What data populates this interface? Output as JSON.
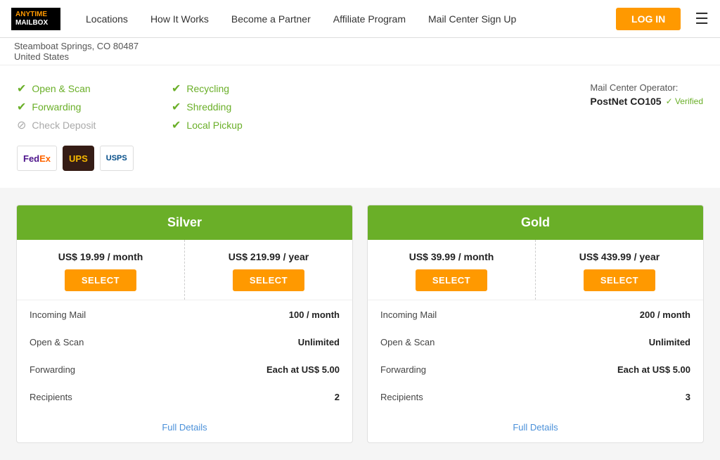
{
  "navbar": {
    "logo_line1": "ANYTIME",
    "logo_line2": "MAILBOX",
    "links": [
      {
        "label": "Locations",
        "id": "locations"
      },
      {
        "label": "How It Works",
        "id": "how-it-works"
      },
      {
        "label": "Become a Partner",
        "id": "become-partner"
      },
      {
        "label": "Affiliate Program",
        "id": "affiliate"
      },
      {
        "label": "Mail Center Sign Up",
        "id": "mail-center-signup"
      }
    ],
    "login_label": "LOG IN",
    "hamburger_icon": "☰"
  },
  "address": {
    "line1": "Steamboat Springs, CO 80487",
    "line2": "United States"
  },
  "features": {
    "col1": [
      {
        "label": "Open & Scan",
        "enabled": true
      },
      {
        "label": "Forwarding",
        "enabled": true
      },
      {
        "label": "Check Deposit",
        "enabled": false
      }
    ],
    "col2": [
      {
        "label": "Recycling",
        "enabled": true
      },
      {
        "label": "Shredding",
        "enabled": true
      },
      {
        "label": "Local Pickup",
        "enabled": true
      }
    ]
  },
  "mail_center": {
    "operator_label": "Mail Center Operator:",
    "name": "PostNet CO105",
    "verified_label": "✓ Verified"
  },
  "carriers": [
    {
      "name": "FedEx",
      "id": "fedex"
    },
    {
      "name": "UPS",
      "id": "ups"
    },
    {
      "name": "USPS",
      "id": "usps"
    }
  ],
  "plans": [
    {
      "id": "silver",
      "name": "Silver",
      "monthly_price": "US$ 19.99 / month",
      "yearly_price": "US$ 219.99 / year",
      "select_label": "SELECT",
      "features": [
        {
          "label": "Incoming Mail",
          "value": "100 / month"
        },
        {
          "label": "Open & Scan",
          "value": "Unlimited"
        },
        {
          "label": "Forwarding",
          "value": "Each at US$ 5.00"
        },
        {
          "label": "Recipients",
          "value": "2"
        }
      ],
      "full_details_label": "Full Details"
    },
    {
      "id": "gold",
      "name": "Gold",
      "monthly_price": "US$ 39.99 / month",
      "yearly_price": "US$ 439.99 / year",
      "select_label": "SELECT",
      "features": [
        {
          "label": "Incoming Mail",
          "value": "200 / month"
        },
        {
          "label": "Open & Scan",
          "value": "Unlimited"
        },
        {
          "label": "Forwarding",
          "value": "Each at US$ 5.00"
        },
        {
          "label": "Recipients",
          "value": "3"
        }
      ],
      "full_details_label": "Full Details"
    }
  ]
}
